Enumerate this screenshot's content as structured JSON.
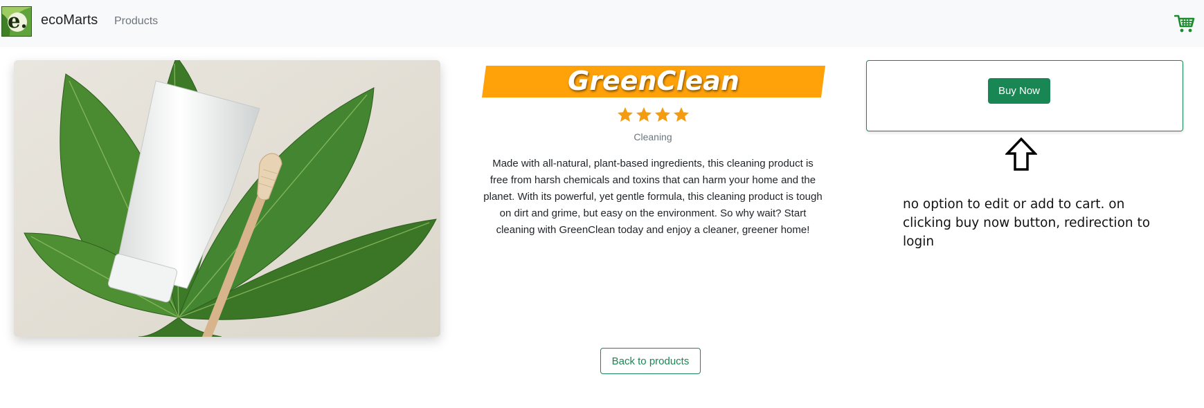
{
  "navbar": {
    "brand_letter": "e.",
    "brand_name": "ecoMarts",
    "nav_products": "Products",
    "cart_icon": "cart-icon"
  },
  "product": {
    "title": "GreenClean",
    "rating": 4,
    "rating_max": 4,
    "category": "Cleaning",
    "description": "Made with all-natural, plant-based ingredients, this cleaning product is free from harsh chemicals and toxins that can harm your home and the planet. With its powerful, yet gentle formula, this cleaning product is tough on dirt and grime, but easy on the environment. So why wait? Start cleaning with GreenClean today and enjoy a cleaner, greener home!"
  },
  "buy_box": {
    "buy_label": "Buy Now"
  },
  "annotation": {
    "text": "no option to edit or add to cart. on clicking buy now button, redirection to login",
    "arrow_icon": "up-arrow-icon"
  },
  "footer": {
    "back_label": "Back to products"
  },
  "colors": {
    "primary_green": "#198754",
    "banner_orange": "#ffa20a",
    "star_orange": "#f39c12",
    "navbar_bg": "#f8f9fa"
  }
}
